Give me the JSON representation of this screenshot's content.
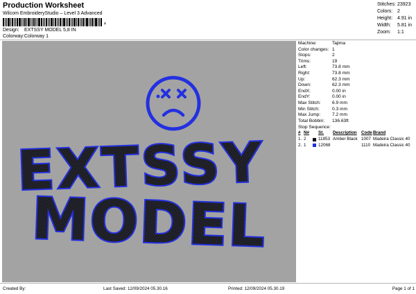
{
  "header": {
    "title": "Production Worksheet",
    "software": "Wilcom EmbroideryStudio – Level 3 Advanced",
    "barcode_mark": ",",
    "design_label": "Design:",
    "design_value": "EXTSSY MODEL 5,8 IN",
    "colorway_label": "Colorway:",
    "colorway_value": "Colorway 1"
  },
  "stats": [
    {
      "key": "Stitches:",
      "value": "23923"
    },
    {
      "key": "Colors:",
      "value": "2"
    },
    {
      "key": "Height:",
      "value": "4.91 in"
    },
    {
      "key": "Width:",
      "value": "5.81 in"
    },
    {
      "key": "Zoom:",
      "value": "1:1"
    }
  ],
  "machine_info": [
    {
      "key": "Machine:",
      "value": "Tajima"
    },
    {
      "key": "Color changes:",
      "value": "1"
    },
    {
      "key": "Stops:",
      "value": "2"
    },
    {
      "key": "Trims:",
      "value": "19"
    },
    {
      "key": "Left:",
      "value": "73.8 mm"
    },
    {
      "key": "Right:",
      "value": "73.8 mm"
    },
    {
      "key": "Up:",
      "value": "62.3 mm"
    },
    {
      "key": "Down:",
      "value": "62.3 mm"
    },
    {
      "key": "EndX:",
      "value": "0.00 in"
    },
    {
      "key": "EndY:",
      "value": "0.00 in"
    },
    {
      "key": "Max Stitch:",
      "value": "6.9 mm"
    },
    {
      "key": "Min Stitch:",
      "value": "0.3 mm"
    },
    {
      "key": "Max Jump:",
      "value": "7.2 mm"
    },
    {
      "key": "Total Bobbin:",
      "value": "136.63ft"
    }
  ],
  "stop_sequence": {
    "label": "Stop Sequence:",
    "headers": [
      "#",
      "N#",
      "",
      "St.",
      "Description",
      "Code",
      "Brand"
    ],
    "rows": [
      {
        "num": "1.",
        "n": "2",
        "color": "#111111",
        "stitches": "11853",
        "description": "Amber Black",
        "code": "1007",
        "brand": "Madeira Classic 40"
      },
      {
        "num": "2.",
        "n": "1",
        "color": "#1f2fe6",
        "stitches": "12068",
        "description": "",
        "code": "1110",
        "brand": "Madeira Classic 40"
      }
    ]
  },
  "design_art": {
    "line1": "EXTSSY",
    "line2": "MODEL",
    "outline_color": "#2330e0",
    "fill_color": "#1c1c24",
    "icon": "sad-dizzy-face-icon"
  },
  "footer": {
    "created_by": "Created By:",
    "last_saved": "Last Saved: 12/09/2024 05.30.16",
    "printed": "Printed: 12/09/2024 05.30.19",
    "page": "Page 1 of 1"
  }
}
